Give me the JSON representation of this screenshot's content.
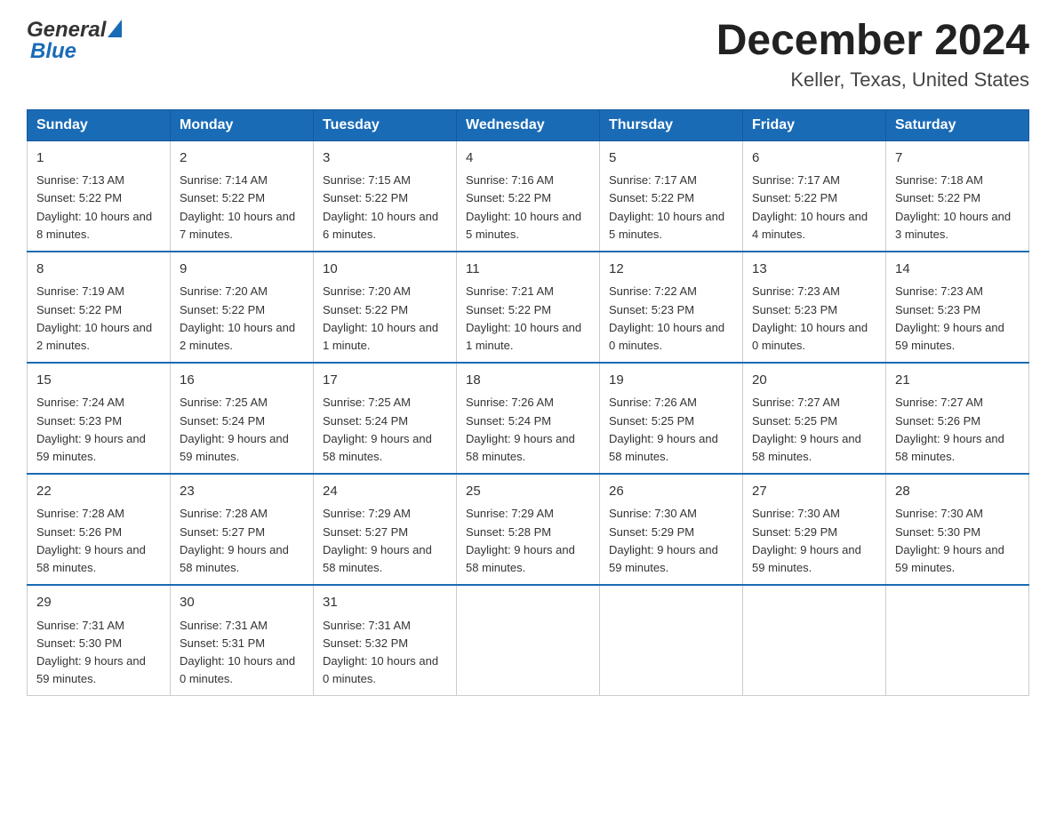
{
  "header": {
    "logo": {
      "general_text": "General",
      "blue_text": "Blue"
    },
    "title": "December 2024",
    "location": "Keller, Texas, United States"
  },
  "calendar": {
    "days_of_week": [
      "Sunday",
      "Monday",
      "Tuesday",
      "Wednesday",
      "Thursday",
      "Friday",
      "Saturday"
    ],
    "weeks": [
      [
        {
          "day": "1",
          "sunrise": "7:13 AM",
          "sunset": "5:22 PM",
          "daylight": "10 hours and 8 minutes."
        },
        {
          "day": "2",
          "sunrise": "7:14 AM",
          "sunset": "5:22 PM",
          "daylight": "10 hours and 7 minutes."
        },
        {
          "day": "3",
          "sunrise": "7:15 AM",
          "sunset": "5:22 PM",
          "daylight": "10 hours and 6 minutes."
        },
        {
          "day": "4",
          "sunrise": "7:16 AM",
          "sunset": "5:22 PM",
          "daylight": "10 hours and 5 minutes."
        },
        {
          "day": "5",
          "sunrise": "7:17 AM",
          "sunset": "5:22 PM",
          "daylight": "10 hours and 5 minutes."
        },
        {
          "day": "6",
          "sunrise": "7:17 AM",
          "sunset": "5:22 PM",
          "daylight": "10 hours and 4 minutes."
        },
        {
          "day": "7",
          "sunrise": "7:18 AM",
          "sunset": "5:22 PM",
          "daylight": "10 hours and 3 minutes."
        }
      ],
      [
        {
          "day": "8",
          "sunrise": "7:19 AM",
          "sunset": "5:22 PM",
          "daylight": "10 hours and 2 minutes."
        },
        {
          "day": "9",
          "sunrise": "7:20 AM",
          "sunset": "5:22 PM",
          "daylight": "10 hours and 2 minutes."
        },
        {
          "day": "10",
          "sunrise": "7:20 AM",
          "sunset": "5:22 PM",
          "daylight": "10 hours and 1 minute."
        },
        {
          "day": "11",
          "sunrise": "7:21 AM",
          "sunset": "5:22 PM",
          "daylight": "10 hours and 1 minute."
        },
        {
          "day": "12",
          "sunrise": "7:22 AM",
          "sunset": "5:23 PM",
          "daylight": "10 hours and 0 minutes."
        },
        {
          "day": "13",
          "sunrise": "7:23 AM",
          "sunset": "5:23 PM",
          "daylight": "10 hours and 0 minutes."
        },
        {
          "day": "14",
          "sunrise": "7:23 AM",
          "sunset": "5:23 PM",
          "daylight": "9 hours and 59 minutes."
        }
      ],
      [
        {
          "day": "15",
          "sunrise": "7:24 AM",
          "sunset": "5:23 PM",
          "daylight": "9 hours and 59 minutes."
        },
        {
          "day": "16",
          "sunrise": "7:25 AM",
          "sunset": "5:24 PM",
          "daylight": "9 hours and 59 minutes."
        },
        {
          "day": "17",
          "sunrise": "7:25 AM",
          "sunset": "5:24 PM",
          "daylight": "9 hours and 58 minutes."
        },
        {
          "day": "18",
          "sunrise": "7:26 AM",
          "sunset": "5:24 PM",
          "daylight": "9 hours and 58 minutes."
        },
        {
          "day": "19",
          "sunrise": "7:26 AM",
          "sunset": "5:25 PM",
          "daylight": "9 hours and 58 minutes."
        },
        {
          "day": "20",
          "sunrise": "7:27 AM",
          "sunset": "5:25 PM",
          "daylight": "9 hours and 58 minutes."
        },
        {
          "day": "21",
          "sunrise": "7:27 AM",
          "sunset": "5:26 PM",
          "daylight": "9 hours and 58 minutes."
        }
      ],
      [
        {
          "day": "22",
          "sunrise": "7:28 AM",
          "sunset": "5:26 PM",
          "daylight": "9 hours and 58 minutes."
        },
        {
          "day": "23",
          "sunrise": "7:28 AM",
          "sunset": "5:27 PM",
          "daylight": "9 hours and 58 minutes."
        },
        {
          "day": "24",
          "sunrise": "7:29 AM",
          "sunset": "5:27 PM",
          "daylight": "9 hours and 58 minutes."
        },
        {
          "day": "25",
          "sunrise": "7:29 AM",
          "sunset": "5:28 PM",
          "daylight": "9 hours and 58 minutes."
        },
        {
          "day": "26",
          "sunrise": "7:30 AM",
          "sunset": "5:29 PM",
          "daylight": "9 hours and 59 minutes."
        },
        {
          "day": "27",
          "sunrise": "7:30 AM",
          "sunset": "5:29 PM",
          "daylight": "9 hours and 59 minutes."
        },
        {
          "day": "28",
          "sunrise": "7:30 AM",
          "sunset": "5:30 PM",
          "daylight": "9 hours and 59 minutes."
        }
      ],
      [
        {
          "day": "29",
          "sunrise": "7:31 AM",
          "sunset": "5:30 PM",
          "daylight": "9 hours and 59 minutes."
        },
        {
          "day": "30",
          "sunrise": "7:31 AM",
          "sunset": "5:31 PM",
          "daylight": "10 hours and 0 minutes."
        },
        {
          "day": "31",
          "sunrise": "7:31 AM",
          "sunset": "5:32 PM",
          "daylight": "10 hours and 0 minutes."
        },
        null,
        null,
        null,
        null
      ]
    ]
  }
}
